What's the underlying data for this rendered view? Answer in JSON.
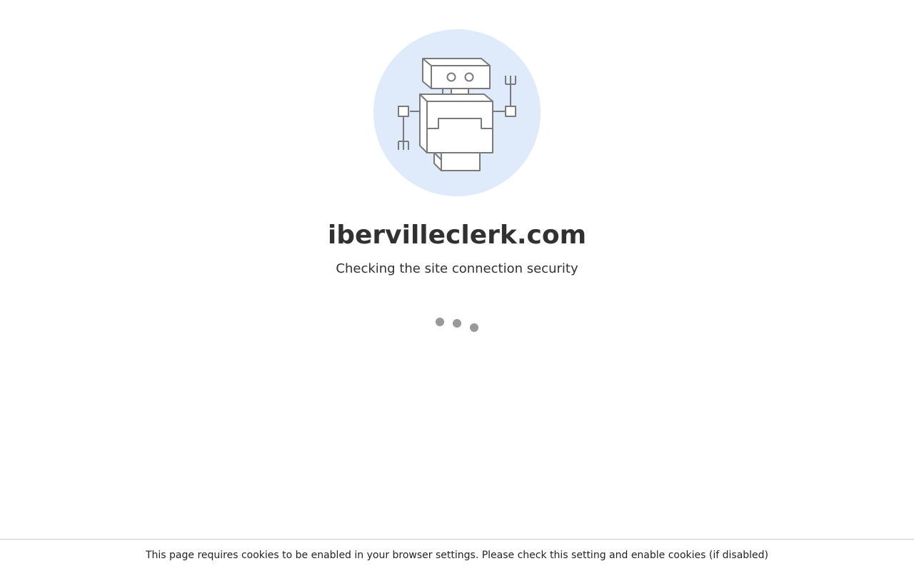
{
  "page": {
    "domain": "ibervilleclerk.com",
    "status_message": "Checking the site connection security"
  },
  "illustration": {
    "icon": "robot-icon",
    "circle_color": "#dfeafb",
    "stroke_color": "#7a7a7a"
  },
  "loader": {
    "icon": "loading-dots-icon",
    "dot_count": 3,
    "dot_color": "#999999"
  },
  "footer": {
    "cookie_notice": "This page requires cookies to be enabled in your browser settings. Please check this setting and enable cookies (if disabled)"
  }
}
